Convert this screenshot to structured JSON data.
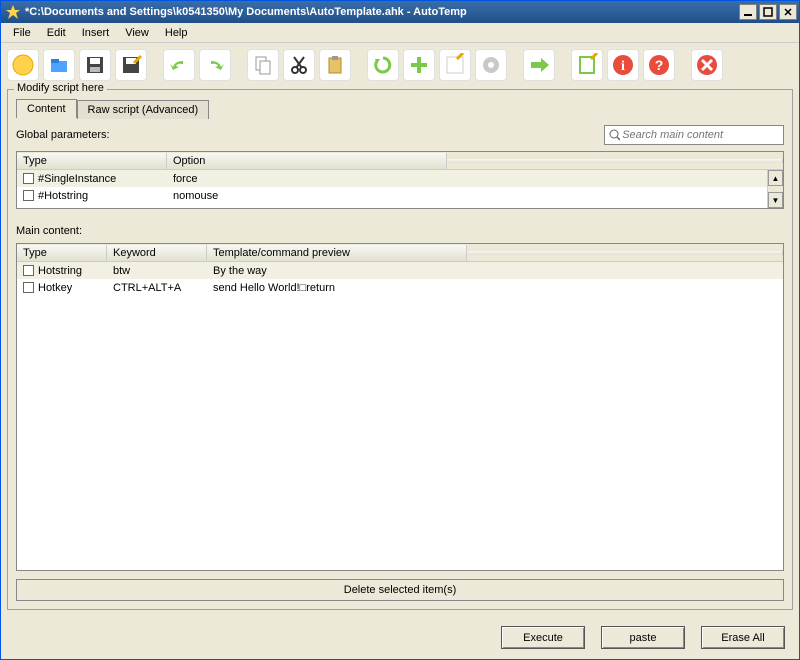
{
  "title": "*C:\\Documents and Settings\\k0541350\\My Documents\\AutoTemplate.ahk - AutoTemp",
  "menu": {
    "file": "File",
    "edit": "Edit",
    "insert": "Insert",
    "view": "View",
    "help": "Help"
  },
  "fieldset_label": "Modify script here",
  "tabs": {
    "content": "Content",
    "raw": "Raw script (Advanced)"
  },
  "global_label": "Global parameters:",
  "search": {
    "placeholder": "Search main content"
  },
  "gp": {
    "head": {
      "type": "Type",
      "option": "Option"
    },
    "rows": [
      {
        "type": "#SingleInstance",
        "option": "force"
      },
      {
        "type": "#Hotstring",
        "option": "nomouse"
      }
    ]
  },
  "main_label": "Main content:",
  "mc": {
    "head": {
      "type": "Type",
      "keyword": "Keyword",
      "preview": "Template/command preview"
    },
    "rows": [
      {
        "type": "Hotstring",
        "keyword": "btw",
        "preview": "By the way"
      },
      {
        "type": "Hotkey",
        "keyword": "CTRL+ALT+A",
        "preview": "send Hello World!□return"
      }
    ]
  },
  "delete_label": "Delete selected item(s)",
  "buttons": {
    "execute": "Execute",
    "paste": "paste",
    "erase": "Erase All"
  }
}
